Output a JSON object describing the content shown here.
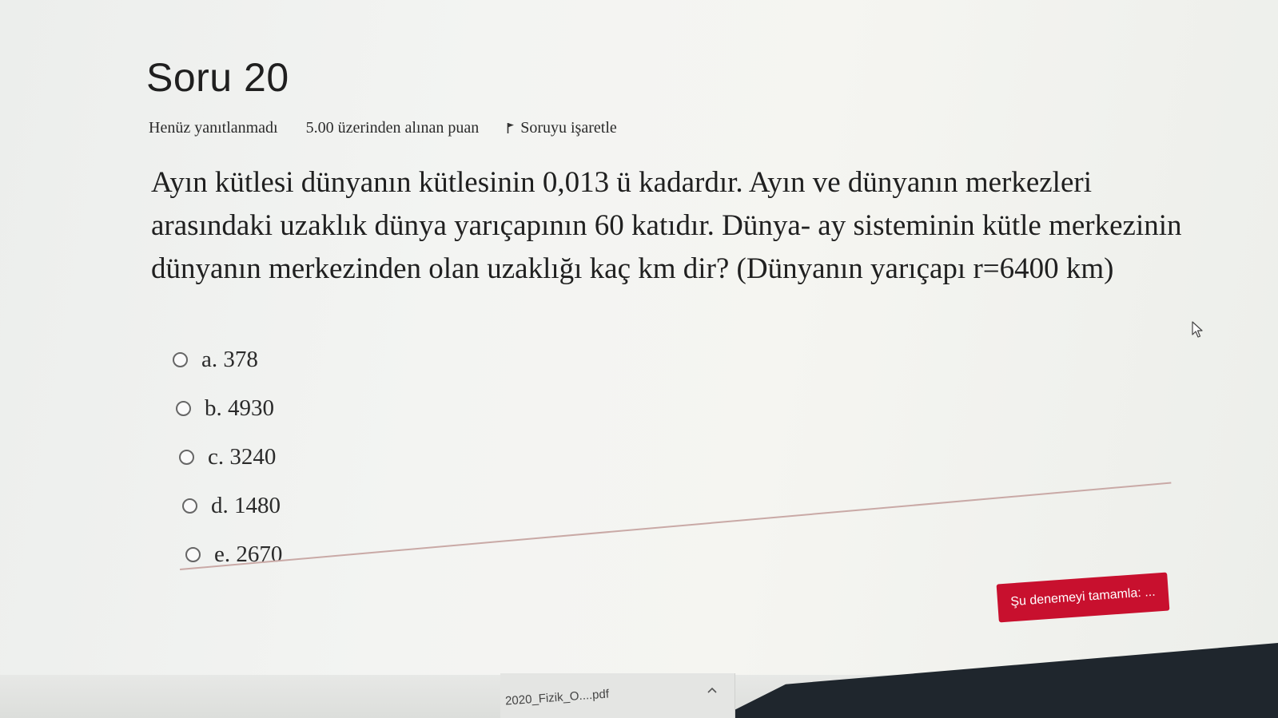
{
  "question": {
    "title": "Soru 20",
    "status": "Henüz yanıtlanmadı",
    "grade": "5.00 üzerinden alınan puan",
    "flag_label": "Soruyu işaretle",
    "text": "Ayın kütlesi dünyanın kütlesinin 0,013 ü kadardır. Ayın ve dünyanın merkezleri arasındaki uzaklık dünya yarıçapının 60 katıdır. Dünya- ay sisteminin kütle merkezinin dünyanın merkezinden olan uzaklığı kaç km dir? (Dünyanın yarıçapı r=6400 km)",
    "options": [
      {
        "label": "a. 378"
      },
      {
        "label": "b. 4930"
      },
      {
        "label": "c. 3240"
      },
      {
        "label": "d. 1480"
      },
      {
        "label": "e. 2670"
      }
    ]
  },
  "actions": {
    "finish_label": "Şu denemeyi tamamla: ..."
  },
  "download_bar": {
    "file_name": "2020_Fizik_O....pdf",
    "icon": "chevron-up-icon"
  },
  "colors": {
    "finish_button": "#c8102e",
    "divider": "#c9a9a6"
  }
}
